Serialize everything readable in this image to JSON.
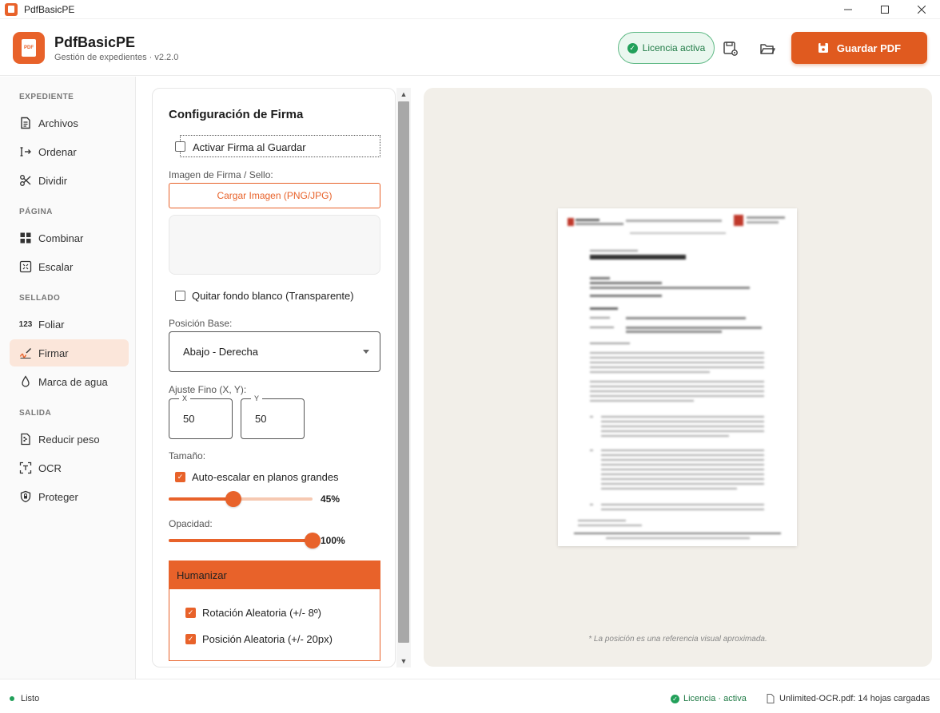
{
  "window": {
    "title": "PdfBasicPE"
  },
  "header": {
    "app_name": "PdfBasicPE",
    "app_subtitle": "Gestión de expedientes · v2.2.0",
    "logo_text": "PDF",
    "license_label": "Licencia activa",
    "save_label": "Guardar PDF",
    "accent_color": "#e8622a"
  },
  "sidebar": {
    "sections": [
      {
        "title": "EXPEDIENTE",
        "items": [
          {
            "label": "Archivos",
            "icon": "file-text-icon"
          },
          {
            "label": "Ordenar",
            "icon": "sort-icon"
          },
          {
            "label": "Dividir",
            "icon": "scissors-icon"
          }
        ]
      },
      {
        "title": "PÁGINA",
        "items": [
          {
            "label": "Combinar",
            "icon": "grid-icon"
          },
          {
            "label": "Escalar",
            "icon": "scale-icon"
          }
        ]
      },
      {
        "title": "SELLADO",
        "items": [
          {
            "label": "Foliar",
            "icon": "numbers-icon"
          },
          {
            "label": "Firmar",
            "icon": "signature-icon",
            "active": true
          },
          {
            "label": "Marca de agua",
            "icon": "drop-icon"
          }
        ]
      },
      {
        "title": "SALIDA",
        "items": [
          {
            "label": "Reducir peso",
            "icon": "compress-icon"
          },
          {
            "label": "OCR",
            "icon": "ocr-icon"
          },
          {
            "label": "Proteger",
            "icon": "shield-icon"
          }
        ]
      }
    ]
  },
  "config": {
    "title": "Configuración de Firma",
    "activate_label": "Activar Firma al Guardar",
    "activate_checked": false,
    "image_label": "Imagen de Firma / Sello:",
    "upload_label": "Cargar Imagen (PNG/JPG)",
    "remove_bg_label": "Quitar fondo blanco (Transparente)",
    "remove_bg_checked": false,
    "position_label": "Posición Base:",
    "position_value": "Abajo - Derecha",
    "fine_label": "Ajuste Fino (X, Y):",
    "x_tag": "X",
    "x_value": "50",
    "y_tag": "Y",
    "y_value": "50",
    "size_label": "Tamaño:",
    "autoscale_label": "Auto-escalar en planos grandes",
    "autoscale_checked": true,
    "size_value": 0.45,
    "size_pct": "45%",
    "opacity_label": "Opacidad:",
    "opacity_value": 1.0,
    "opacity_pct": "100%",
    "humanize": {
      "title": "Humanizar",
      "rotation_label": "Rotación Aleatoria (+/- 8º)",
      "rotation_checked": true,
      "position_label": "Posición Aleatoria (+/- 20px)",
      "position_checked": true
    }
  },
  "preview": {
    "note": "* La posición es una referencia visual aproximada."
  },
  "status": {
    "state": "Listo",
    "license": "Licencia · activa",
    "file_info": "Unlimited-OCR.pdf: 14 hojas cargadas"
  }
}
